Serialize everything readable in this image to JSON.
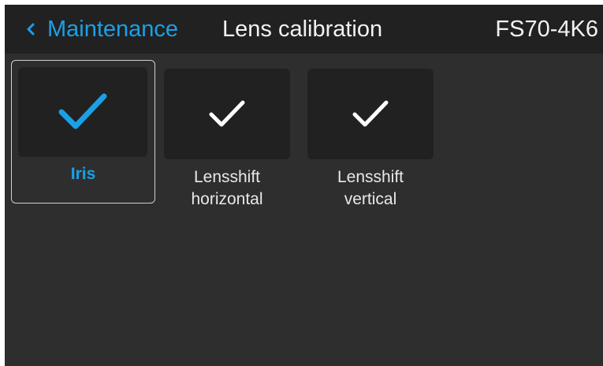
{
  "header": {
    "back_label": "Maintenance",
    "title": "Lens calibration",
    "device": "FS70-4K6"
  },
  "tiles": [
    {
      "label": "Iris",
      "icon": "checkmark-icon",
      "selected": true
    },
    {
      "label_line1": "Lensshift",
      "label_line2": "horizontal",
      "icon": "checkmark-icon",
      "selected": false
    },
    {
      "label_line1": "Lensshift",
      "label_line2": "vertical",
      "icon": "checkmark-icon",
      "selected": false
    }
  ],
  "colors": {
    "accent": "#1aa0e6",
    "background": "#2e2e2e",
    "header_background": "#212121",
    "tile_background": "#212121",
    "text": "#f2f2f2"
  }
}
